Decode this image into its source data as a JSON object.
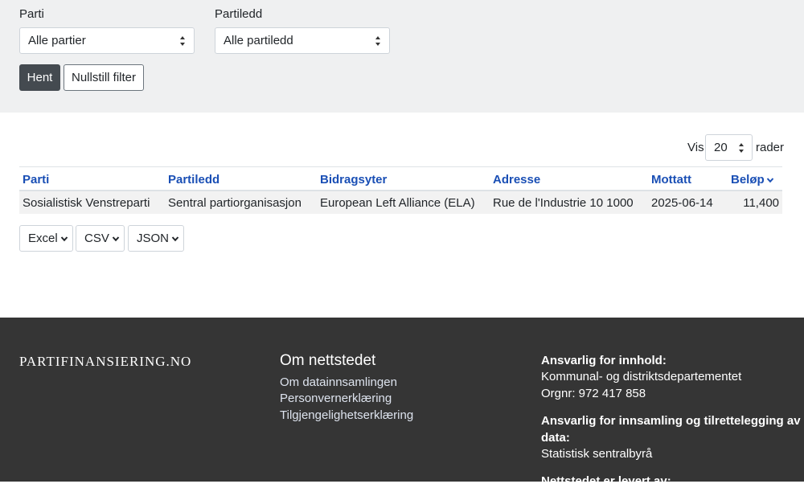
{
  "filters": {
    "parti_label": "Parti",
    "parti_value": "Alle partier",
    "partiledd_label": "Partiledd",
    "partiledd_value": "Alle partiledd",
    "fetch_button": "Hent",
    "reset_button": "Nullstill filter"
  },
  "paging": {
    "show_label": "Vis",
    "rows_value": "20",
    "rows_label": "rader"
  },
  "table": {
    "headers": [
      "Parti",
      "Partiledd",
      "Bidragsyter",
      "Adresse",
      "Mottatt",
      "Beløp"
    ],
    "rows": [
      [
        "Sosialistisk Venstreparti",
        "Sentral partiorganisasjon",
        "European Left Alliance (ELA)",
        "Rue de l'Industrie 10 1000",
        "2025-06-14",
        "11,400"
      ]
    ]
  },
  "export": {
    "excel": "Excel",
    "csv": "CSV",
    "json": "JSON"
  },
  "footer": {
    "brand": "PARTIFINANSIERING.NO",
    "about_heading": "Om nettstedet",
    "links": [
      "Om datainnsamlingen",
      "Personvernerklæring",
      "Tilgjengelighetserklæring"
    ],
    "content_heading": "Ansvarlig for innhold:",
    "content_org": "Kommunal- og distriktsdepartementet",
    "content_orgnr": "Orgnr: 972 417 858",
    "data_heading_1": "Ansvarlig for innsamling og tilrettelegging av",
    "data_heading_2": "data:",
    "data_org": "Statistisk sentralbyrå",
    "delivered_heading": "Nettstedet er levert av:"
  },
  "colors": {
    "link": "#1a4fb5",
    "dark_button": "#444a50",
    "filter_bg": "#eff0f1",
    "footer_bg": "#353535"
  }
}
